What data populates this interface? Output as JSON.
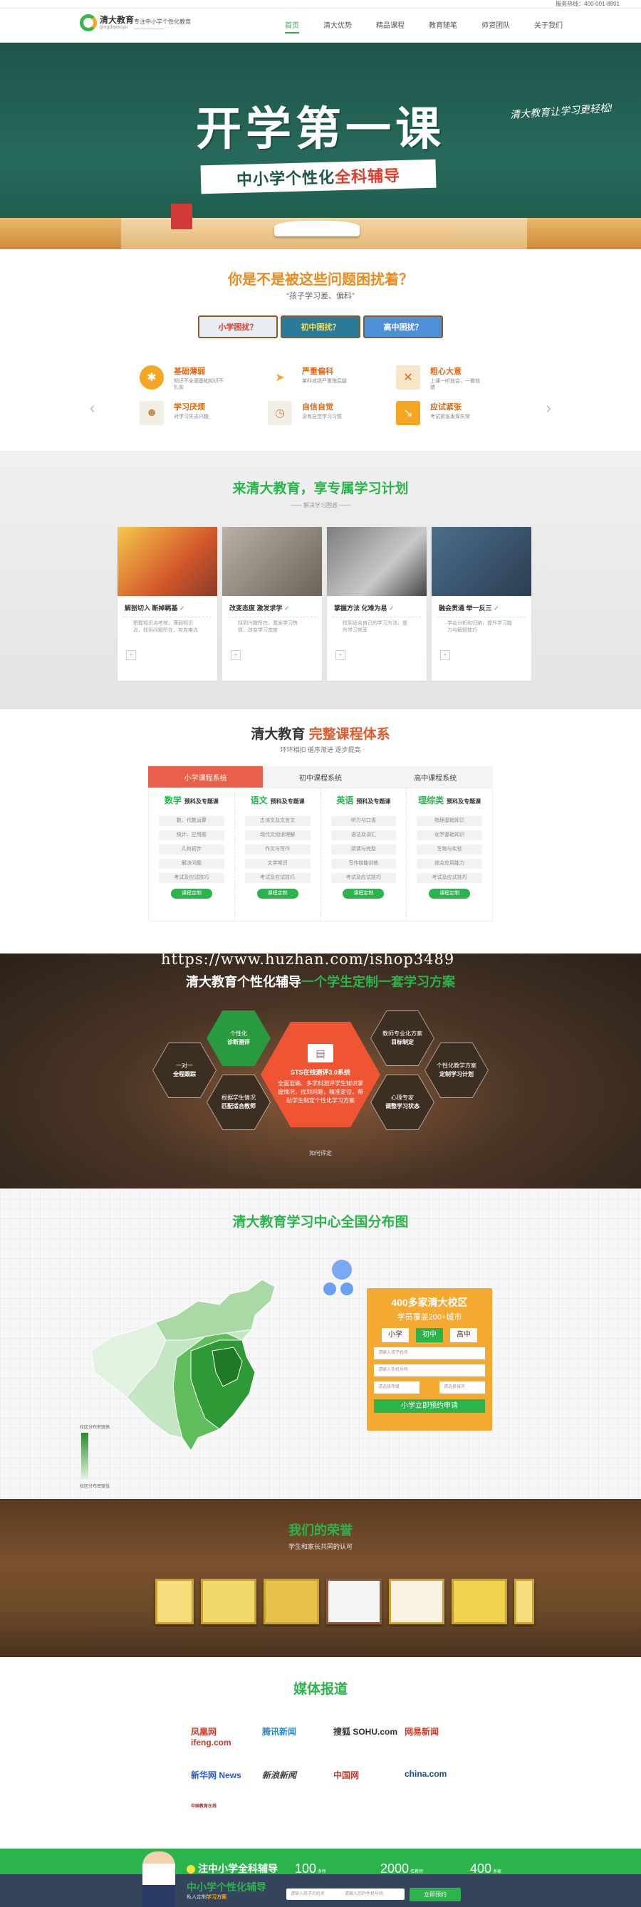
{
  "topbar": {
    "hotline_label": "服务热线：",
    "hotline": "400-001-8801"
  },
  "header": {
    "logo_name": "清大教育",
    "logo_sub": "qingdajiaoyu",
    "slogan": "专注中小学个性化教育",
    "slogan_sub": "——————",
    "nav": [
      {
        "label": "首页",
        "active": true
      },
      {
        "label": "清大优势",
        "active": false
      },
      {
        "label": "精品课程",
        "active": false
      },
      {
        "label": "教育随笔",
        "active": false
      },
      {
        "label": "师资团队",
        "active": false
      },
      {
        "label": "关于我们",
        "active": false
      }
    ]
  },
  "hero": {
    "title": "开学第一课",
    "subtitle_prefix": "中小学个性化",
    "subtitle_highlight": "全科辅导",
    "slogan": "清大教育让学习更轻松!"
  },
  "problems": {
    "title": "你是不是被这些问题困扰着？",
    "subtitle": "“孩子学习差、偏科”",
    "tabs": [
      "小学困扰？",
      "初中困扰？",
      "高中困扰？"
    ],
    "items": [
      {
        "icon": "ball-icon",
        "title": "基础薄弱",
        "desc": "知识不全面基础知识不扎实",
        "color": "#f5a623"
      },
      {
        "icon": "paper-plane-icon",
        "title": "严重偏科",
        "desc": "某科成绩严重拖后腿",
        "color": "#f5a623"
      },
      {
        "icon": "notebook-icon",
        "title": "粗心大意",
        "desc": "上课一听就会，一做就错",
        "color": "#f5a623"
      },
      {
        "icon": "mask-icon",
        "title": "学习厌烦",
        "desc": "对学习失去兴趣",
        "color": "#f5a623"
      },
      {
        "icon": "clock-icon",
        "title": "自信自觉",
        "desc": "没有自觉学习习惯",
        "color": "#f5a623"
      },
      {
        "icon": "trend-icon",
        "title": "应试紧张",
        "desc": "考试紧张发挥失常",
        "color": "#f5a623"
      }
    ]
  },
  "plans": {
    "title": "来清大教育，享专属学习计划",
    "subtitle": "—— 解决学习困惑 ——",
    "cards": [
      {
        "t1": "解剖切入",
        "t2": "断掉羁基",
        "desc": "把握知识点考核，薄弱知识点，找到问题所在，攻克难点"
      },
      {
        "t1": "改变态度",
        "t2": "激发求学",
        "desc": "找到兴趣所在，激发学习热情，改变学习态度"
      },
      {
        "t1": "掌握方法",
        "t2": "化难为易",
        "desc": "找到适合自己的学习方法，提升学习效率"
      },
      {
        "t1": "融会贯通",
        "t2": "举一反三",
        "desc": "学会分析和归纳，提升学习能力与解题技巧"
      }
    ]
  },
  "courses": {
    "title_prefix": "清大教育",
    "title_highlight": "完整课程体系",
    "subtitle": "环环相扣 循序渐进 逐步提高",
    "tabs": [
      {
        "label": "小学课程系统",
        "active": true
      },
      {
        "label": "初中课程系统",
        "active": false
      },
      {
        "label": "高中课程系统",
        "active": false
      }
    ],
    "columns": [
      {
        "subject": "数学",
        "tag": "预科及专题课",
        "items": [
          "数、代数运算",
          "统计、应用题",
          "几何初步",
          "解决问题",
          "考试及应试技巧"
        ],
        "button": "课程定制"
      },
      {
        "subject": "语文",
        "tag": "预科及专题课",
        "items": [
          "古诗文及文言文",
          "现代文阅读理解",
          "作文与写作",
          "文学常识",
          "考试及应试技巧"
        ],
        "button": "课程定制"
      },
      {
        "subject": "英语",
        "tag": "预科及专题课",
        "items": [
          "听力与口语",
          "语法及词汇",
          "阅读与完型",
          "写作技能训练",
          "考试及应试技巧"
        ],
        "button": "课程定制"
      },
      {
        "subject": "理综类",
        "tag": "预科及专题课",
        "items": [
          "物理基础知识",
          "化学基础知识",
          "生物与实验",
          "综合应用能力",
          "考试及应试技巧"
        ],
        "button": "课程定制"
      }
    ]
  },
  "personal": {
    "watermark": "https://www.huzhan.com/ishop3489",
    "title_prefix": "清大教育个性化辅导",
    "title_highlight": "一个学生定制一套学习方案",
    "center_title": "STS在线测评3.0系统",
    "center_desc": "全面准确、多学科测评学生知识掌握情况，找到问题，精准定位，帮助学生制定个性化学习方案",
    "hexes": [
      {
        "a": "个性化",
        "b": "诊断测评",
        "style": "green"
      },
      {
        "a": "教师专业化方案",
        "b": "目标制定",
        "style": "line"
      },
      {
        "a": "一对一",
        "b": "全程跟踪",
        "style": "line"
      },
      {
        "a": "个性化教学方案",
        "b": "定制学习计划",
        "style": "line"
      },
      {
        "a": "根据学生情况",
        "b": "匹配适合教师",
        "style": "line"
      },
      {
        "a": "心理专家",
        "b": "调整学习状态",
        "style": "line"
      }
    ],
    "more": "如何评定"
  },
  "mapsec": {
    "title": "清大教育学习中心全国分布图",
    "legend_high": "校区分布密度高",
    "legend_low": "校区分布密度低",
    "form": {
      "title": "400多家清大校区",
      "subtitle": "学员覆盖200+城市",
      "levels": [
        {
          "label": "小学",
          "active": false
        },
        {
          "label": "初中",
          "active": true
        },
        {
          "label": "高中",
          "active": false
        }
      ],
      "name_ph": "请输入孩子姓名",
      "phone_ph": "请输入手机号码",
      "grade_ph": "请选择年级",
      "city_ph": "请选择城市",
      "submit": "小学立即预约申请"
    }
  },
  "honors": {
    "title": "我们的荣誉",
    "subtitle": "学生和家长共同的认可"
  },
  "media": {
    "title": "媒体报道",
    "logos": [
      "凤凰网 ifeng.com",
      "腾讯新闻",
      "搜狐 SOHU.com",
      "网易新闻",
      "新华网 News",
      "新浪新闻",
      "中国网",
      "china.com",
      "中国教育在线"
    ]
  },
  "bottombar": {
    "line1": "注中小学全科辅导",
    "line2": "中小学个性化辅导",
    "line3_prefix": "私人定制",
    "line3_highlight": "学习方案",
    "stats": [
      {
        "value": "100",
        "unit": "多所"
      },
      {
        "value": "2000",
        "unit": "名教师"
      },
      {
        "value": "400",
        "unit": "多家"
      }
    ],
    "name_ph": "请输入孩子的姓名",
    "phone_ph": "请输入您的手机号码",
    "submit": "立即预约"
  }
}
